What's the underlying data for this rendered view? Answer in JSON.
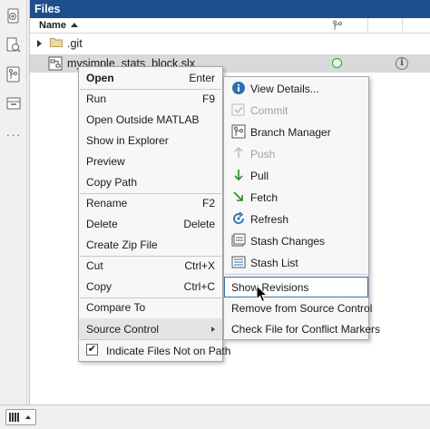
{
  "window": {
    "panel_title": "Files"
  },
  "rail": {
    "icons": [
      "current-folder-icon",
      "search-files-icon",
      "source-control-icon",
      "project-icon"
    ],
    "more": "···"
  },
  "columns": {
    "name": "Name"
  },
  "files": [
    {
      "name": ".git",
      "type": "folder"
    },
    {
      "name": "mysimple_stats_block.slx",
      "type": "simulink-model",
      "status": "unmodified",
      "info": "i"
    }
  ],
  "context_menu": {
    "items": [
      {
        "label": "Open",
        "shortcut": "Enter"
      },
      {
        "label": "Run",
        "shortcut": "F9"
      },
      {
        "label": "Open Outside MATLAB"
      },
      {
        "label": "Show in Explorer"
      },
      {
        "label": "Preview"
      },
      {
        "label": "Copy Path"
      },
      {
        "label": "Rename",
        "shortcut": "F2"
      },
      {
        "label": "Delete",
        "shortcut": "Delete"
      },
      {
        "label": "Create Zip File"
      },
      {
        "label": "Cut",
        "shortcut": "Ctrl+X"
      },
      {
        "label": "Copy",
        "shortcut": "Ctrl+C"
      },
      {
        "label": "Compare To"
      },
      {
        "label": "Source Control"
      },
      {
        "label": "Indicate Files Not on Path",
        "checked": true
      }
    ]
  },
  "submenu": {
    "items": [
      {
        "label": "View Details...",
        "icon": "info-icon"
      },
      {
        "label": "Commit",
        "icon": "commit-icon",
        "disabled": true
      },
      {
        "label": "Branch Manager",
        "icon": "branch-icon"
      },
      {
        "label": "Push",
        "icon": "push-icon",
        "disabled": true
      },
      {
        "label": "Pull",
        "icon": "pull-icon"
      },
      {
        "label": "Fetch",
        "icon": "fetch-icon"
      },
      {
        "label": "Refresh",
        "icon": "refresh-icon"
      },
      {
        "label": "Stash Changes",
        "icon": "stash-changes-icon"
      },
      {
        "label": "Stash List",
        "icon": "stash-list-icon"
      },
      {
        "label": "Show Revisions",
        "focused": true
      },
      {
        "label": "Remove from Source Control"
      },
      {
        "label": "Check File for Conflict Markers"
      }
    ]
  },
  "colors": {
    "titlebar": "#1f4e8c",
    "status_green": "#2aa02a",
    "selection": "#d9d9d9"
  }
}
